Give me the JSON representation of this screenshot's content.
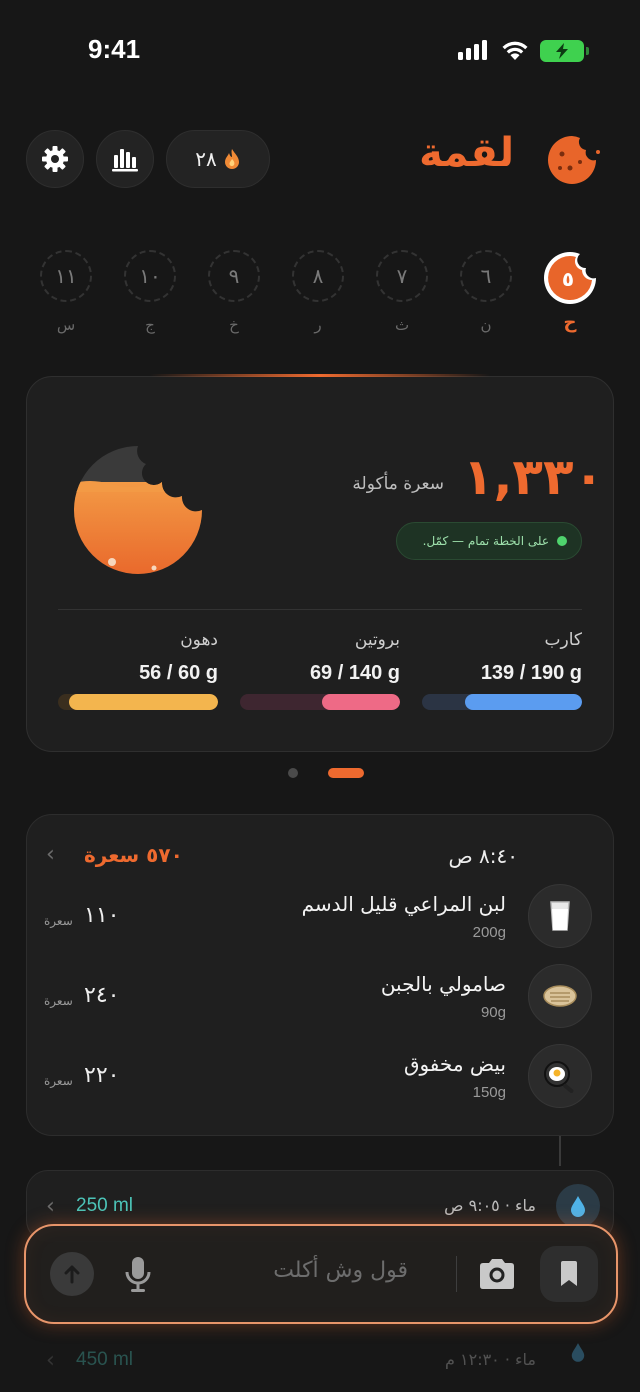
{
  "status_bar": {
    "time": "9:41"
  },
  "header": {
    "app_name": "لقمة",
    "streak_count": "٢٨",
    "streak_icon": "flame-icon",
    "stats_icon": "bar-chart-icon",
    "settings_icon": "gear-icon"
  },
  "days": [
    {
      "num": "٥",
      "label": "ح",
      "active": true
    },
    {
      "num": "٦",
      "label": "ن"
    },
    {
      "num": "٧",
      "label": "ث"
    },
    {
      "num": "٨",
      "label": "ر"
    },
    {
      "num": "٩",
      "label": "خ"
    },
    {
      "num": "١٠",
      "label": "ج"
    },
    {
      "num": "١١",
      "label": "س"
    }
  ],
  "summary": {
    "calories": "١,٣٣٠",
    "calories_label": "سعرة مأكولة",
    "plan_status": "على الخطة تمام — كمّل.",
    "macros": [
      {
        "name": "كارب",
        "value": "139 / 190 g",
        "progress": 0.73,
        "color": "#5b9cf0",
        "track": "#2b3444"
      },
      {
        "name": "بروتين",
        "value": "69 / 140 g",
        "progress": 0.49,
        "color": "#ee6a86",
        "track": "#3e2630"
      },
      {
        "name": "دهون",
        "value": "56 / 60 g",
        "progress": 0.93,
        "color": "#f3b54e",
        "track": "#3a2e1e"
      }
    ]
  },
  "meal": {
    "time": "٨:٤٠ ص",
    "total": "٥٧٠ سعرة",
    "items": [
      {
        "name": "لبن المراعي قليل الدسم",
        "weight": "200g",
        "kcal": "١١٠",
        "unit": "سعرة",
        "icon": "milk-glass-icon"
      },
      {
        "name": "صامولي بالجبن",
        "weight": "90g",
        "kcal": "٢٤٠",
        "unit": "سعرة",
        "icon": "bread-roll-icon"
      },
      {
        "name": "بيض مخفوق",
        "weight": "150g",
        "kcal": "٢٢٠",
        "unit": "سعرة",
        "icon": "frying-pan-egg-icon"
      }
    ]
  },
  "water": [
    {
      "label": "ماء · ٩:٠٥ ص",
      "amount": "250 ml",
      "icon": "water-drop-icon"
    },
    {
      "label": "ماء · ١٢:٣٠ م",
      "amount": "450 ml",
      "icon": "water-drop-icon"
    }
  ],
  "input": {
    "placeholder": "قول وش أكلت",
    "send_icon": "arrow-up-icon",
    "mic_icon": "microphone-icon",
    "camera_icon": "camera-icon",
    "saved_icon": "bookmark-icon"
  }
}
